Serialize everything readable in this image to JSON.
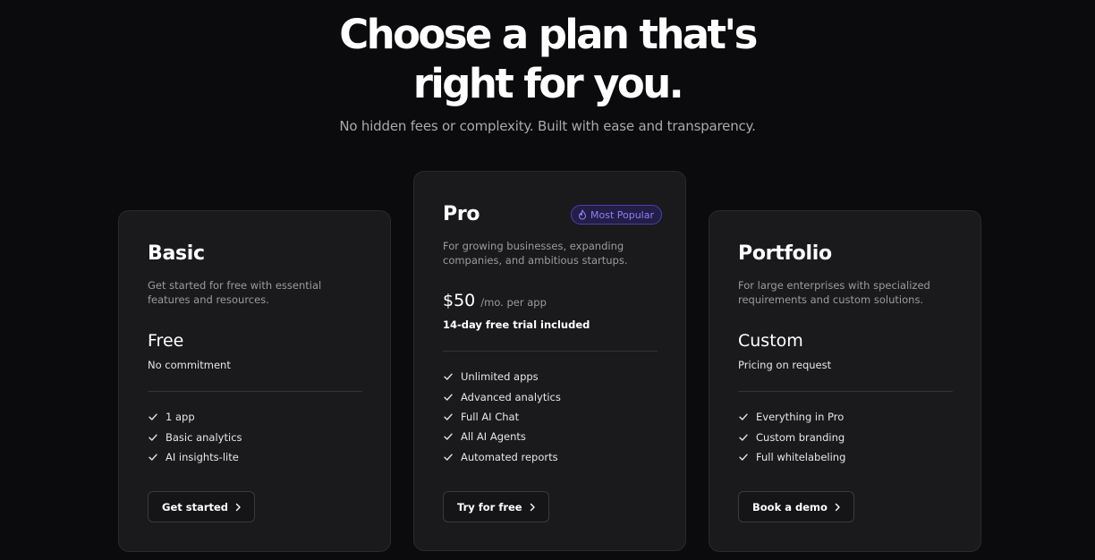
{
  "hero": {
    "title_line1": "Choose a plan that's",
    "title_line2": "right for you.",
    "subtitle": "No hidden fees or complexity. Built with ease and transparency."
  },
  "plans": [
    {
      "name": "Basic",
      "description": "Get started for free with essential features and resources.",
      "price": "Free",
      "price_note": "No commitment",
      "features": [
        "1 app",
        "Basic analytics",
        "AI insights-lite"
      ],
      "cta": "Get started"
    },
    {
      "name": "Pro",
      "badge": "Most Popular",
      "badge_icon": "flame-icon",
      "description": "For growing businesses, expanding companies, and ambitious startups.",
      "price": "$50",
      "price_unit": "/mo. per app",
      "price_note": "14-day free trial included",
      "features": [
        "Unlimited apps",
        "Advanced analytics",
        "Full AI Chat",
        "All AI Agents",
        "Automated reports"
      ],
      "cta": "Try for free"
    },
    {
      "name": "Portfolio",
      "description": "For large enterprises with specialized requirements and custom solutions.",
      "price": "Custom",
      "price_note": "Pricing on request",
      "features": [
        "Everything in Pro",
        "Custom branding",
        "Full whitelabeling"
      ],
      "cta": "Book a demo"
    }
  ],
  "colors": {
    "background": "#0b0b0d",
    "card": "#1a1a1c",
    "card_border": "#2a2a2d",
    "badge_text": "#8f7ff7",
    "badge_bg": "#221e46",
    "muted_text": "#9b9ba0"
  },
  "icons": {
    "feature": "check-icon",
    "cta": "chevron-right-icon"
  }
}
